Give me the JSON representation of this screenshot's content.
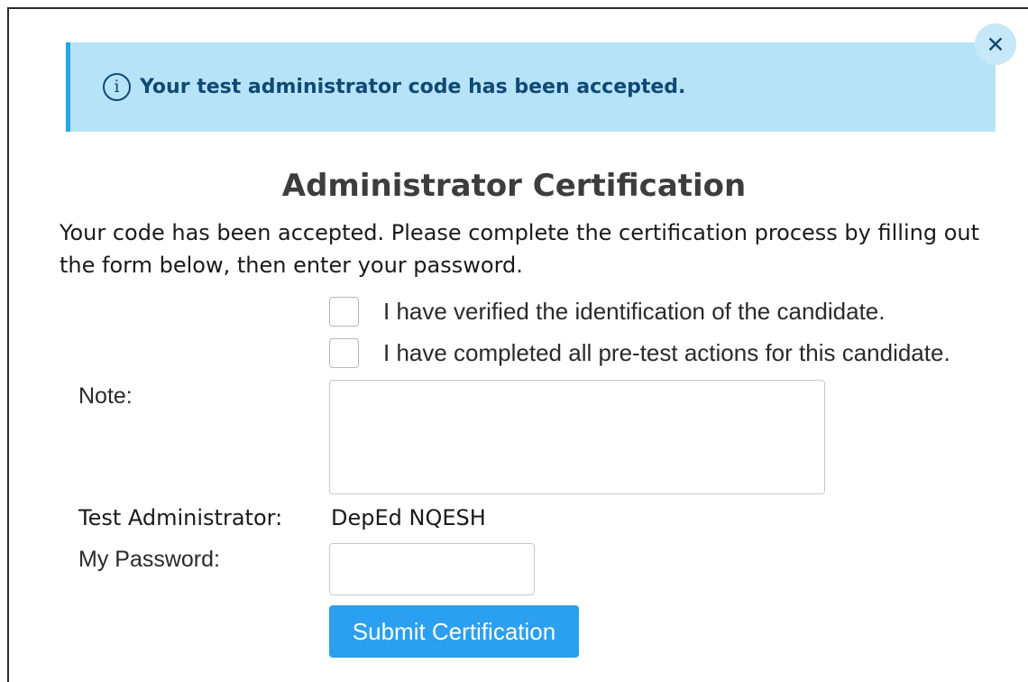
{
  "alert": {
    "icon": "info-icon",
    "icon_glyph": "i",
    "message": "Your test administrator code has been accepted.",
    "close_glyph": "✕",
    "close_icon": "close-icon"
  },
  "form": {
    "title": "Administrator Certification",
    "intro": "Your code has been accepted. Please complete the certification process by filling out the form below, then enter your password.",
    "checks": [
      {
        "label": "I have verified the identification of the candidate.",
        "checked": false
      },
      {
        "label": "I have completed all pre-test actions for this candidate.",
        "checked": false
      }
    ],
    "note_label": "Note:",
    "note_value": "",
    "admin_label": "Test Administrator:",
    "admin_value": "DepEd NQESH",
    "password_label": "My Password:",
    "password_value": "",
    "submit_label": "Submit Certification"
  },
  "colors": {
    "alert_bg": "#b7e3f8",
    "alert_accent": "#2aa6e4",
    "alert_text": "#0f4a75",
    "submit_bg": "#2b9ff0"
  }
}
